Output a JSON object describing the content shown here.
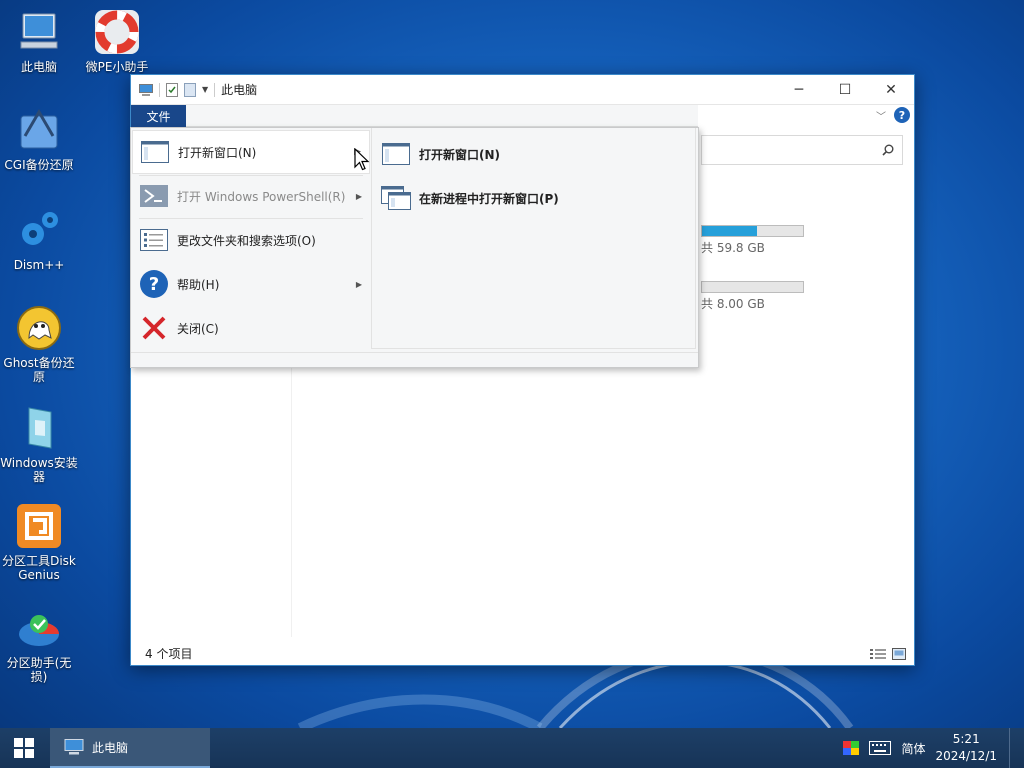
{
  "desktop": {
    "icons": [
      {
        "label": "此电脑"
      },
      {
        "label": "微PE小助手"
      },
      {
        "label": "CGI备份还原"
      },
      {
        "label": "Dism++"
      },
      {
        "label": "Ghost备份还原"
      },
      {
        "label": "Windows安装器"
      },
      {
        "label": "分区工具DiskGenius"
      },
      {
        "label": "分区助手(无损)"
      }
    ]
  },
  "window": {
    "title": "此电脑",
    "controls": {
      "minimize": "─",
      "maximize": "☐",
      "close": "✕"
    },
    "drives": [
      {
        "text": "共 59.8 GB",
        "used_fraction": 0.54
      },
      {
        "text": "共 8.00 GB",
        "used_fraction": 0.0
      }
    ],
    "status": "4 个项目",
    "help": "?"
  },
  "file_menu": {
    "tab_label": "文件",
    "items": [
      {
        "label": "打开新窗口(N)",
        "has_submenu": true,
        "active": true
      },
      {
        "label": "打开 Windows PowerShell(R)",
        "has_submenu": true,
        "disabled": true
      },
      {
        "label": "更改文件夹和搜索选项(O)"
      },
      {
        "label": "帮助(H)",
        "has_submenu": true
      },
      {
        "label": "关闭(C)"
      }
    ],
    "submenu": [
      {
        "label": "打开新窗口(N)"
      },
      {
        "label": "在新进程中打开新窗口(P)"
      }
    ]
  },
  "taskbar": {
    "app_label": "此电脑",
    "ime": "简体",
    "time": "5:21",
    "date": "2024/12/1"
  }
}
